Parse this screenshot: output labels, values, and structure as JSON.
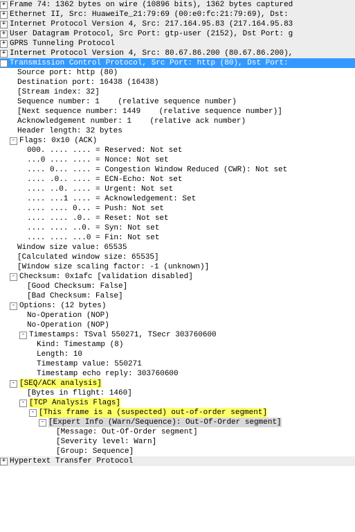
{
  "top": [
    {
      "exp": "+",
      "text": "Frame 74: 1362 bytes on wire (10896 bits), 1362 bytes captured"
    },
    {
      "exp": "+",
      "text": "Ethernet II, Src: HuaweiTe_21:79:69 (00:e0:fc:21:79:69), Dst:"
    },
    {
      "exp": "+",
      "text": "Internet Protocol Version 4, Src: 217.164.95.83 (217.164.95.83"
    },
    {
      "exp": "+",
      "text": "User Datagram Protocol, Src Port: gtp-user (2152), Dst Port: g"
    },
    {
      "exp": "+",
      "text": "GPRS Tunneling Protocol"
    },
    {
      "exp": "+",
      "text": "Internet Protocol Version 4, Src: 80.67.86.200 (80.67.86.200),"
    }
  ],
  "tcp_header": "Transmission Control Protocol, Src Port: http (80), Dst Port:",
  "tcp": {
    "src": "Source port: http (80)",
    "dst": "Destination port: 16438 (16438)",
    "stream": "[Stream index: 32]",
    "seq": "Sequence number: 1    (relative sequence number)",
    "nseq": "[Next sequence number: 1449    (relative sequence number)]",
    "ack": "Acknowledgement number: 1    (relative ack number)",
    "hlen": "Header length: 32 bytes"
  },
  "flags_header": "Flags: 0x10 (ACK)",
  "flags": [
    "000. .... .... = Reserved: Not set",
    "...0 .... .... = Nonce: Not set",
    ".... 0... .... = Congestion Window Reduced (CWR): Not set",
    ".... .0.. .... = ECN-Echo: Not set",
    ".... ..0. .... = Urgent: Not set",
    ".... ...1 .... = Acknowledgement: Set",
    ".... .... 0... = Push: Not set",
    ".... .... .0.. = Reset: Not set",
    ".... .... ..0. = Syn: Not set",
    ".... .... ...0 = Fin: Not set"
  ],
  "win": {
    "val": "Window size value: 65535",
    "calc": "[Calculated window size: 65535]",
    "scale": "[Window size scaling factor: -1 (unknown)]"
  },
  "chk_header": "Checksum: 0x1afc [validation disabled]",
  "chk": {
    "good": "[Good Checksum: False]",
    "bad": "[Bad Checksum: False]"
  },
  "opt_header": "Options: (12 bytes)",
  "opt": {
    "nop1": "No-Operation (NOP)",
    "nop2": "No-Operation (NOP)",
    "ts_header": "Timestamps: TSval 550271, TSecr 303760600",
    "ts": {
      "kind": "Kind: Timestamp (8)",
      "len": "Length: 10",
      "val": "Timestamp value: 550271",
      "echo": "Timestamp echo reply: 303760600"
    }
  },
  "seqack_header": "[SEQ/ACK analysis]",
  "seqack": {
    "bif": "[Bytes in flight: 1460]",
    "af_header": "[TCP Analysis Flags]",
    "ooo": "[This frame is a (suspected) out-of-order segment]",
    "expert": "[Expert Info (Warn/Sequence): Out-Of-Order segment]",
    "msg": "[Message: Out-Of-Order segment]",
    "sev": "[Severity level: Warn]",
    "grp": "[Group: Sequence]"
  },
  "http": "Hypertext Transfer Protocol"
}
